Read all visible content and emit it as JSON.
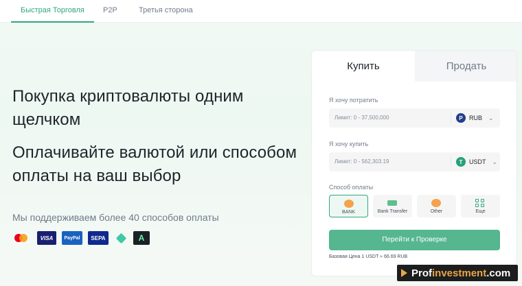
{
  "tabs": [
    {
      "label": "Быстрая Торговля",
      "active": true
    },
    {
      "label": "P2P",
      "active": false
    },
    {
      "label": "Третья сторона",
      "active": false
    }
  ],
  "hero": {
    "title_line1": "Покупка криптовалюты одним щелчком",
    "title_line2": "Оплачивайте валютой или способом оплаты на ваш выбор",
    "subtitle": "Мы поддерживаем более 40 способов оплаты",
    "payment_logos": [
      "mastercard",
      "VISA",
      "PayPal",
      "SEPA",
      "diamond-logo",
      "A"
    ]
  },
  "card": {
    "buy_tab": "Купить",
    "sell_tab": "Продать",
    "spend": {
      "label": "Я хочу потратить",
      "placeholder": "Лимит: 0 - 37,500,000",
      "currency": "RUB",
      "coin_letter": "P"
    },
    "receive": {
      "label": "Я хочу купить",
      "placeholder": "Лимит: 0 - 562,303.19",
      "currency": "USDT",
      "coin_letter": "T"
    },
    "method_label": "Способ оплаты",
    "methods": [
      {
        "label": "BANK",
        "icon": "bank-icon",
        "selected": true
      },
      {
        "label": "Bank Transfer",
        "icon": "card-icon",
        "selected": false
      },
      {
        "label": "Other",
        "icon": "coin-icon",
        "selected": false
      },
      {
        "label": "Еще",
        "icon": "grid-icon",
        "selected": false
      }
    ],
    "cta": "Перейти к Проверке",
    "base_rate": "Базовая Цена 1 USDT ≈ 66.69 RUB"
  },
  "watermark": {
    "prefix": "Prof",
    "mid": "investment",
    "suffix": ".com"
  },
  "colors": {
    "accent": "#2fa77e",
    "button": "#55b690",
    "text": "#1e2329",
    "muted": "#707a8a"
  }
}
